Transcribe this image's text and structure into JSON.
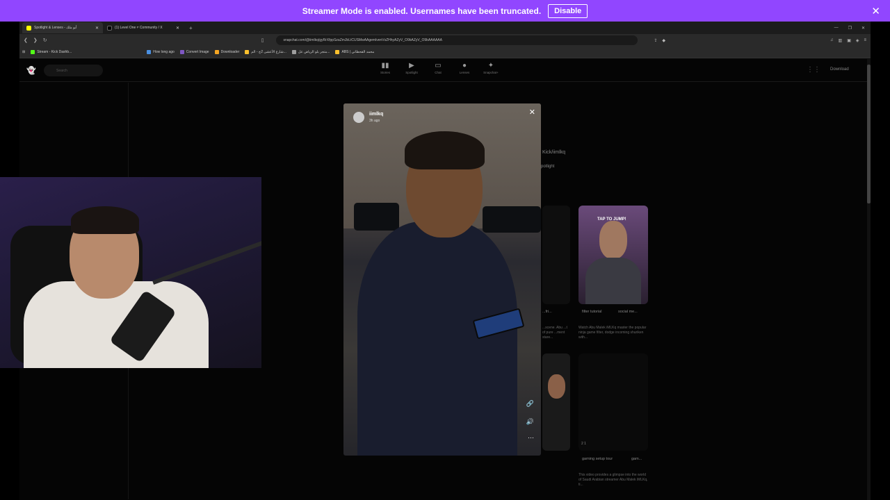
{
  "banner": {
    "text": "Streamer Mode is enabled. Usernames have been truncated.",
    "button": "Disable"
  },
  "tabs": [
    {
      "label": "Spotlight & Lenses - أبو ملك"
    },
    {
      "label": "(1) Level One ≠ Community / X"
    }
  ],
  "address": {
    "url": "snapchat.com/@iimlkq/gyRrXfppSzaZmJbLtCUSMwAAgemlvenVsZHhyAZyV_O9bAZyV_O9bAAAAAA"
  },
  "bookmarks": [
    {
      "label": "Stream - Kick Dashb...",
      "color": "#53fc18"
    },
    {
      "label": "How long ago",
      "color": "#4a90e2"
    },
    {
      "label": "Convert Image",
      "color": "#7e57c2"
    },
    {
      "label": "Downloader",
      "color": "#f5a623"
    },
    {
      "label": "شارع الأعشى 2ج - الم...",
      "color": "#fbc02d"
    },
    {
      "label": "متجر بلو الرياض عل...",
      "color": "#9e9e9e"
    },
    {
      "label": "ABS | محمد القحطاني",
      "color": "#fbc02d"
    }
  ],
  "snap_nav": {
    "search_placeholder": "Search",
    "items": [
      {
        "label": "Stories",
        "icon": "stories-icon"
      },
      {
        "label": "Spotlight",
        "icon": "spotlight-icon"
      },
      {
        "label": "Chat",
        "icon": "chat-icon"
      },
      {
        "label": "Lenses",
        "icon": "lenses-icon"
      },
      {
        "label": "Snapchat+",
        "icon": "snapchat-plus-icon"
      }
    ],
    "download": "Download"
  },
  "profile": {
    "name": "iiMLKq",
    "link": "Kick/iimlkq",
    "tab": "Spotlight"
  },
  "cards": {
    "right_top_title": "filter tutorial",
    "right_top_title2": "social me...",
    "right_top_overlay": "TAP TO JUMP!",
    "right_top_desc": "Watch Abu Malek iMLKq master the popular ninja game filter, dodge incoming shuriken with...",
    "left_mid_desc": "...scene. Abu ...t of pure ...ment stare...",
    "left_mid_tag": "...fri...",
    "right_bottom_stats": "2  1",
    "right_bottom_title": "gaming setup tour",
    "right_bottom_title2": "gam...",
    "right_bottom_desc": "This video provides a glimpse into the world of Saudi Arabian streamer Abu Malek iMLKq, ti..."
  },
  "modal": {
    "username": "iimlkq",
    "time": "3h ago"
  },
  "colors": {
    "banner": "#9146ff",
    "snap_yellow": "#fffc00"
  }
}
